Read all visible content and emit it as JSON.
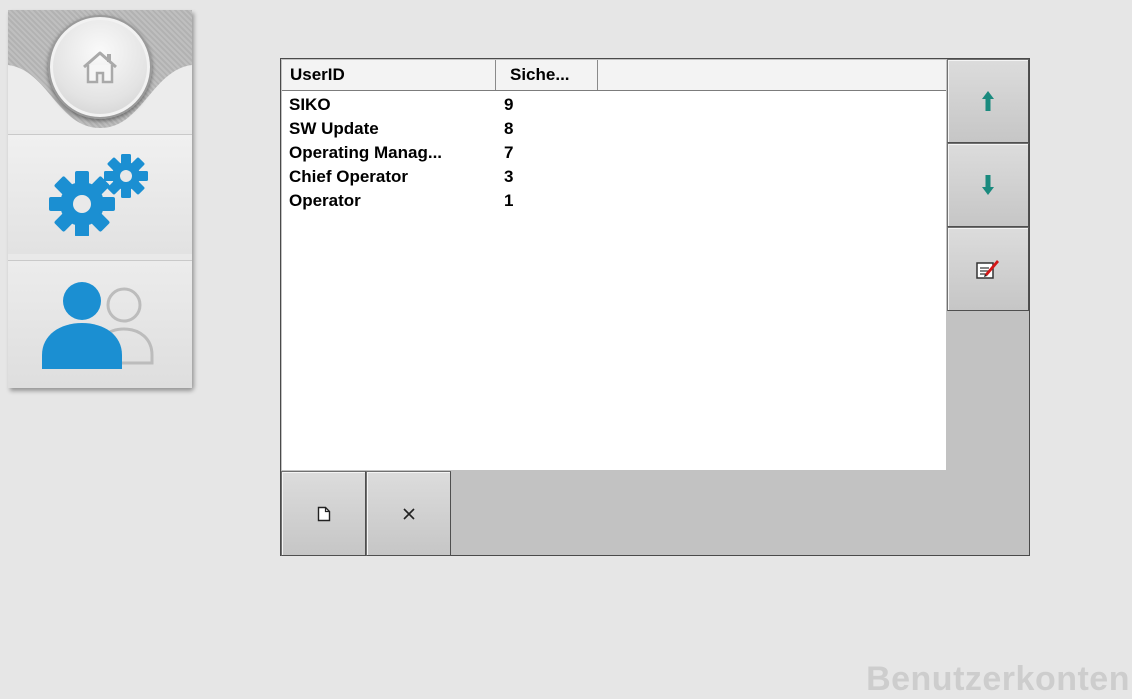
{
  "navigation": {
    "home_icon": "home-icon",
    "settings_icon": "gears-icon",
    "users_icon": "users-icon"
  },
  "user_list": {
    "columns": [
      "UserID",
      "Siche..."
    ],
    "rows": [
      {
        "user_id": "SIKO",
        "level": "9"
      },
      {
        "user_id": "SW Update",
        "level": "8"
      },
      {
        "user_id": "Operating Manag...",
        "level": "7"
      },
      {
        "user_id": "Chief Operator",
        "level": "3"
      },
      {
        "user_id": "Operator",
        "level": "1"
      }
    ]
  },
  "buttons": {
    "move_up_icon": "arrow-up-icon",
    "move_down_icon": "arrow-down-icon",
    "edit_icon": "edit-note-icon",
    "new_icon": "new-document-icon",
    "delete_icon": "close-icon"
  },
  "colors": {
    "accent_blue": "#1b8fd2",
    "arrow_teal": "#1a8a7e",
    "edit_red": "#d41616"
  },
  "page_title": "Benutzerkonten"
}
